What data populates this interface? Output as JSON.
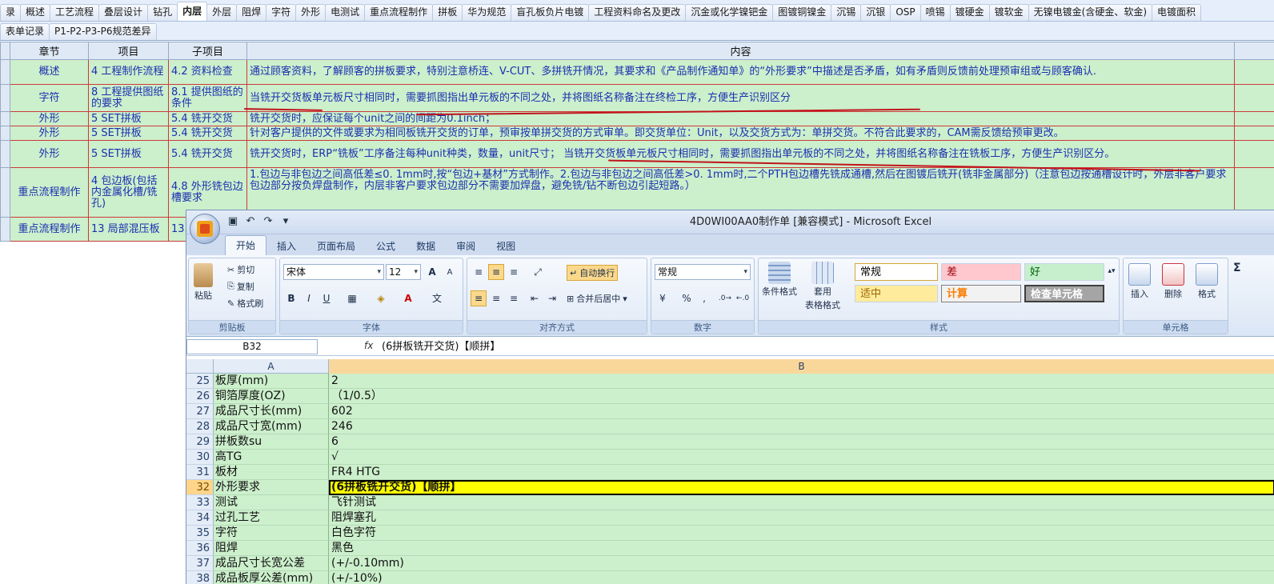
{
  "top_tabs": [
    "录",
    "概述",
    "工艺流程",
    "叠层设计",
    "钻孔",
    "内层",
    "外层",
    "阻焊",
    "字符",
    "外形",
    "电测试",
    "重点流程制作",
    "拼板",
    "华为规范",
    "盲孔板负片电镀",
    "工程资料命名及更改",
    "沉金或化学镍钯金",
    "图镀铜镍金",
    "沉锡",
    "沉银",
    "OSP",
    "喷锡",
    "镀硬金",
    "镀软金",
    "无镍电镀金(含硬金、软金)",
    "电镀面积"
  ],
  "top_tabs_active": "内层",
  "second_tabs": [
    "表单记录",
    "P1-P2-P3-P6规范差异"
  ],
  "doc_table": {
    "headers": [
      "章节",
      "项目",
      "子项目",
      "内容"
    ],
    "rows": [
      {
        "chapter": "概述",
        "item": "4 工程制作流程",
        "sub": "4.2 资料检查",
        "content": "通过顾客资料，了解顾客的拼板要求，特别注意桥连、V-CUT、多拼铣开情况，其要求和《产品制作通知单》的“外形要求”中描述是否矛盾，如有矛盾则反馈前处理预审组或与顾客确认."
      },
      {
        "chapter": "字符",
        "item": "8 工程提供图纸的要求",
        "sub": "8.1 提供图纸的条件",
        "content": "当铣开交货板单元板尺寸相同时，需要抓图指出单元板的不同之处，并将图纸名称备注在终检工序，方便生产识别区分"
      },
      {
        "chapter": "外形",
        "item": "5 SET拼板",
        "sub": "5.4 铣开交货",
        "content": "铣开交货时，应保证每个unit之间的间距为0.1inch；"
      },
      {
        "chapter": "外形",
        "item": "5 SET拼板",
        "sub": "5.4 铣开交货",
        "content": "针对客户提供的文件或要求为相同板铣开交货的订单，预审按单拼交货的方式审单。即交货单位：Unit，以及交货方式为：单拼交货。不符合此要求的，CAM需反馈给预审更改。"
      },
      {
        "chapter": "外形",
        "item": "5 SET拼板",
        "sub": "5.4 铣开交货",
        "content": "铣开交货时，ERP“铣板”工序备注每种unit种类，数量，unit尺寸； 当铣开交货板单元板尺寸相同时，需要抓图指出单元板的不同之处，并将图纸名称备注在铣板工序，方便生产识别区分。"
      },
      {
        "chapter": "重点流程制作",
        "item": "4 包边板(包括内金属化槽/铣孔)",
        "sub": "4.8 外形铣包边槽要求",
        "content": "1.包边与非包边之间高低差≤0. 1mm时,按“包边+基材”方式制作。2.包边与非包边之间高低差>0. 1mm时,二个PTH包边槽先铣成通槽,然后在图镀后铣开(铣非金属部分)（注意包边按通槽设计时，外层非客户要求包边部分按负焊盘制作，内层非客户要求包边部分不需要加焊盘，避免铣/钻不断包边引起短路。）"
      },
      {
        "chapter": "重点流程制作",
        "item": "13 局部混压板",
        "sub": "13.",
        "content": ""
      }
    ]
  },
  "excel": {
    "title": "4D0WI00AA0制作单  [兼容模式] - Microsoft Excel",
    "ribbon_tabs": [
      "开始",
      "插入",
      "页面布局",
      "公式",
      "数据",
      "审阅",
      "视图"
    ],
    "active_ribbon_tab": "开始",
    "clipboard": {
      "paste": "粘贴",
      "cut": "剪切",
      "copy": "复制",
      "format_painter": "格式刷",
      "label": "剪贴板"
    },
    "font": {
      "name": "宋体",
      "size": "12",
      "label": "字体",
      "bold": "B",
      "italic": "I",
      "underline": "U"
    },
    "alignment": {
      "wrap": "自动换行",
      "merge": "合并后居中",
      "label": "对齐方式"
    },
    "number": {
      "format": "常规",
      "label": "数字",
      "percent": "%"
    },
    "styles": {
      "cond_format": "条件格式",
      "table_format_1": "套用",
      "table_format_2": "表格格式",
      "label": "样式",
      "cells": [
        "常规",
        "差",
        "好",
        "适中",
        "计算",
        "检查单元格"
      ]
    },
    "cells_group": {
      "insert": "插入",
      "delete": "删除",
      "format": "格式",
      "label": "单元格"
    },
    "sigma": "Σ",
    "name_box": "B32",
    "fx": "fx",
    "formula": "(6拼板铣开交货)【顺拼】",
    "col_a": "A",
    "col_b": "B",
    "rows": [
      {
        "n": "25",
        "a": "板厚(mm)",
        "b": "2"
      },
      {
        "n": "26",
        "a": "铜箔厚度(OZ)",
        "b": "（1/0.5）"
      },
      {
        "n": "27",
        "a": "成品尺寸长(mm)",
        "b": "602"
      },
      {
        "n": "28",
        "a": "成品尺寸宽(mm)",
        "b": "246"
      },
      {
        "n": "29",
        "a": "拼板数su",
        "b": "6"
      },
      {
        "n": "30",
        "a": "高TG",
        "b": "√"
      },
      {
        "n": "31",
        "a": "板材",
        "b": "FR4 HTG"
      },
      {
        "n": "32",
        "a": "外形要求",
        "b": "(6拼板铣开交货)【顺拼】"
      },
      {
        "n": "33",
        "a": "测试",
        "b": "飞针测试"
      },
      {
        "n": "34",
        "a": "过孔工艺",
        "b": "阻焊塞孔"
      },
      {
        "n": "35",
        "a": "字符",
        "b": "白色字符"
      },
      {
        "n": "36",
        "a": "阻焊",
        "b": "黑色"
      },
      {
        "n": "37",
        "a": "成品尺寸长宽公差",
        "b": "(+/-0.10mm)"
      },
      {
        "n": "38",
        "a": "成品板厚公差(mm)",
        "b": "(+/-10%)"
      }
    ],
    "selected_row": "32"
  }
}
